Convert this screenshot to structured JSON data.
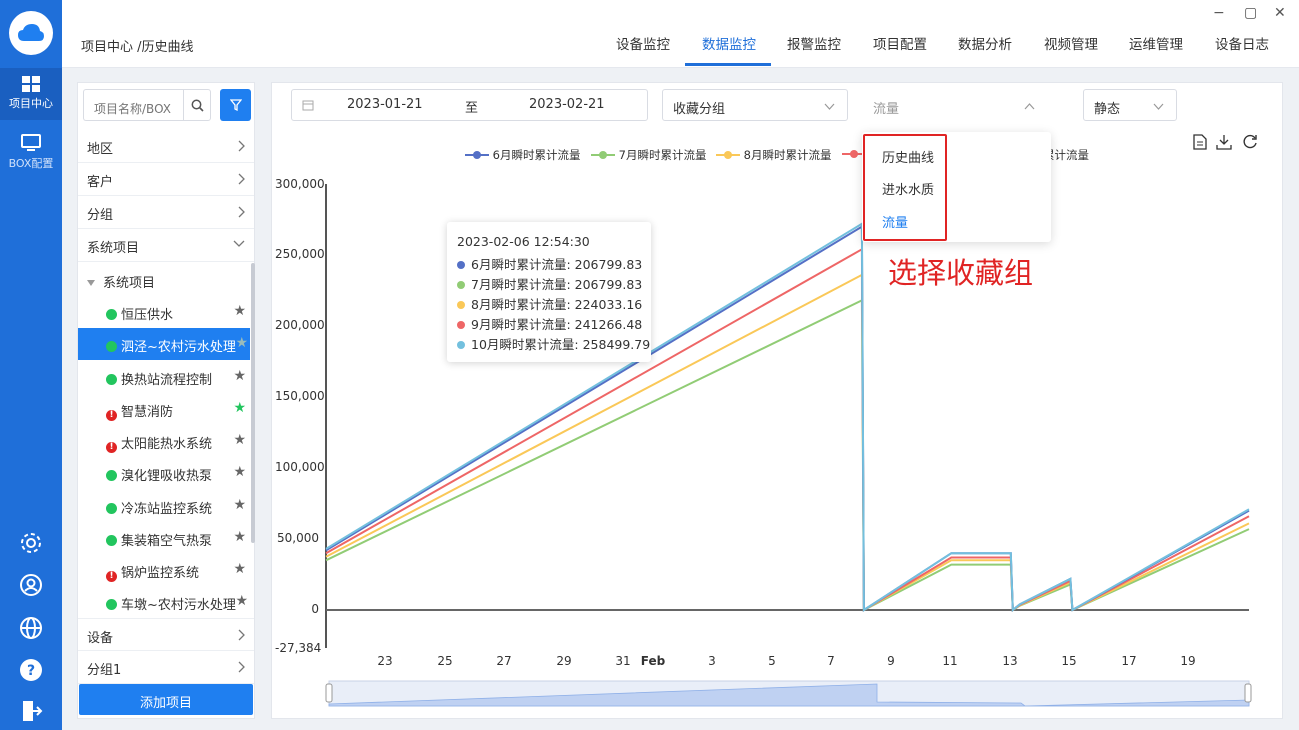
{
  "nav": {
    "breadcrumb": "项目中心 /历史曲线",
    "tabs": [
      "设备监控",
      "数据监控",
      "报警监控",
      "项目配置",
      "数据分析",
      "视频管理",
      "运维管理",
      "设备日志"
    ],
    "active": "数据监控"
  },
  "rail": {
    "project_center": "项目中心",
    "box_config": "BOX配置"
  },
  "window": {
    "minimize": "−",
    "maximize": "▢",
    "close": "✕"
  },
  "sidebar": {
    "search_placeholder": "项目名称/BOX",
    "groups": [
      {
        "label": "地区"
      },
      {
        "label": "客户"
      },
      {
        "label": "分组"
      },
      {
        "label": "系统项目"
      }
    ],
    "tree_root": "系统项目",
    "items": [
      {
        "label": "恒压供水",
        "status": "ok",
        "starred": false
      },
      {
        "label": "泗泾~农村污水处理",
        "status": "ok",
        "starred": false,
        "selected": true
      },
      {
        "label": "换热站流程控制",
        "status": "ok",
        "starred": false
      },
      {
        "label": "智慧消防",
        "status": "error",
        "starred": true
      },
      {
        "label": "太阳能热水系统",
        "status": "error",
        "starred": false
      },
      {
        "label": "溴化锂吸收热泵",
        "status": "ok",
        "starred": false
      },
      {
        "label": "冷冻站监控系统",
        "status": "ok",
        "starred": false
      },
      {
        "label": "集装箱空气热泵",
        "status": "ok",
        "starred": false
      },
      {
        "label": "锅炉监控系统",
        "status": "error",
        "starred": false
      },
      {
        "label": "车墩~农村污水处理",
        "status": "ok",
        "starred": false
      }
    ],
    "bottom_groups": [
      {
        "label": "设备"
      },
      {
        "label": "分组1"
      }
    ],
    "add_button": "添加项目"
  },
  "toolbar": {
    "date_start": "2023-01-21",
    "date_to": "至",
    "date_end": "2023-02-21",
    "collect_group": "收藏分组",
    "metric": "流量",
    "mode": "静态"
  },
  "dropdown": {
    "items": [
      "历史曲线",
      "进水水质",
      "流量"
    ],
    "selected": "流量"
  },
  "annotation": "选择收藏组",
  "legend_tail": "累计流量",
  "tooltip": {
    "time": "2023-02-06 12:54:30",
    "rows": [
      {
        "label": "6月瞬时累计流量: 206799.83",
        "color": "#5470c6"
      },
      {
        "label": "7月瞬时累计流量: 206799.83",
        "color": "#91cc75"
      },
      {
        "label": "8月瞬时累计流量: 224033.16",
        "color": "#fac858"
      },
      {
        "label": "9月瞬时累计流量: 241266.48",
        "color": "#ee6666"
      },
      {
        "label": "10月瞬时累计流量: 258499.79",
        "color": "#73c0de"
      }
    ]
  },
  "chart_data": {
    "type": "line",
    "x_tick_labels": [
      "23",
      "25",
      "27",
      "29",
      "31",
      "Feb",
      "3",
      "5",
      "7",
      "9",
      "11",
      "13",
      "15",
      "17",
      "19"
    ],
    "y_tick_labels": [
      "300,000",
      "250,000",
      "200,000",
      "150,000",
      "100,000",
      "50,000",
      "0",
      "-27,384"
    ],
    "ylim": [
      -27384,
      300000
    ],
    "x_dates": [
      "2023-01-21",
      "2023-02-08",
      "2023-02-08",
      "2023-02-11",
      "2023-02-13",
      "2023-02-13",
      "2023-02-13",
      "2023-02-15",
      "2023-02-15",
      "2023-02-21"
    ],
    "series": [
      {
        "name": "6月瞬时累计流量",
        "color": "#5470c6",
        "values": [
          42000,
          270000,
          0,
          40000,
          40000,
          0,
          4000,
          22000,
          0,
          70000
        ]
      },
      {
        "name": "7月瞬时累计流量",
        "color": "#91cc75",
        "values": [
          35000,
          218000,
          0,
          32000,
          32000,
          0,
          3000,
          18000,
          0,
          57000
        ]
      },
      {
        "name": "8月瞬时累计流量",
        "color": "#fac858",
        "values": [
          37500,
          236000,
          0,
          35000,
          35000,
          0,
          3300,
          19500,
          0,
          61000
        ]
      },
      {
        "name": "9月瞬时累计流量",
        "color": "#ee6666",
        "values": [
          40000,
          254000,
          0,
          37000,
          37000,
          0,
          3600,
          20500,
          0,
          66000
        ]
      },
      {
        "name": "10月瞬时累计流量",
        "color": "#73c0de",
        "values": [
          43000,
          272000,
          0,
          40000,
          40000,
          0,
          4000,
          22000,
          0,
          71000
        ]
      }
    ]
  }
}
